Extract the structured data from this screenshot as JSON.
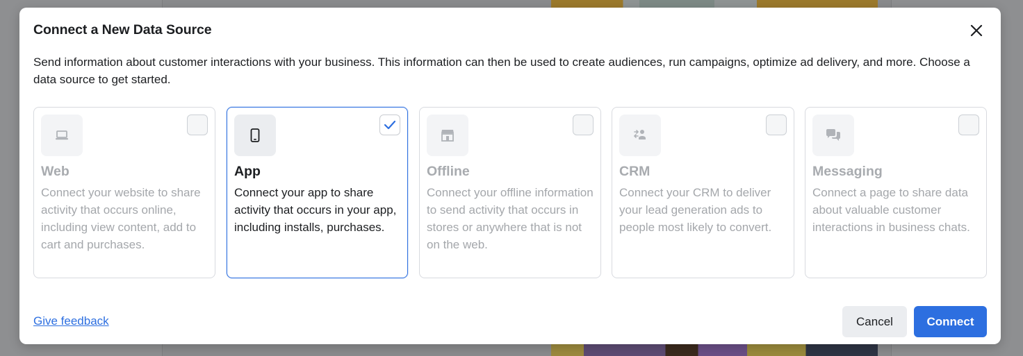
{
  "dialog": {
    "title": "Connect a New Data Source",
    "intro": "Send information about customer interactions with your business. This information can then be used to create audiences, run campaigns, optimize ad delivery, and more. Choose a data source to get started.",
    "close_icon": "close-icon"
  },
  "sources": [
    {
      "title": "Web",
      "description": "Connect your website to share activity that occurs online, including view content, add to cart and purchases.",
      "icon": "laptop-icon",
      "selected": false
    },
    {
      "title": "App",
      "description": "Connect your app to share activity that occurs in your app, including installs, purchases.",
      "icon": "phone-icon",
      "selected": true
    },
    {
      "title": "Offline",
      "description": "Connect your offline information to send activity that occurs in stores or anywhere that is not on the web.",
      "icon": "store-icon",
      "selected": false
    },
    {
      "title": "CRM",
      "description": "Connect your CRM to deliver your lead generation ads to people most likely to convert.",
      "icon": "people-sync-icon",
      "selected": false
    },
    {
      "title": "Messaging",
      "description": "Connect a page to share data about valuable customer interactions in business chats.",
      "icon": "chat-bubbles-icon",
      "selected": false
    }
  ],
  "footer": {
    "feedback_label": "Give feedback",
    "cancel_label": "Cancel",
    "connect_label": "Connect"
  },
  "colors": {
    "accent": "#2d6fe0",
    "text_primary": "#1c1e21",
    "text_disabled": "#a4a7ab"
  }
}
